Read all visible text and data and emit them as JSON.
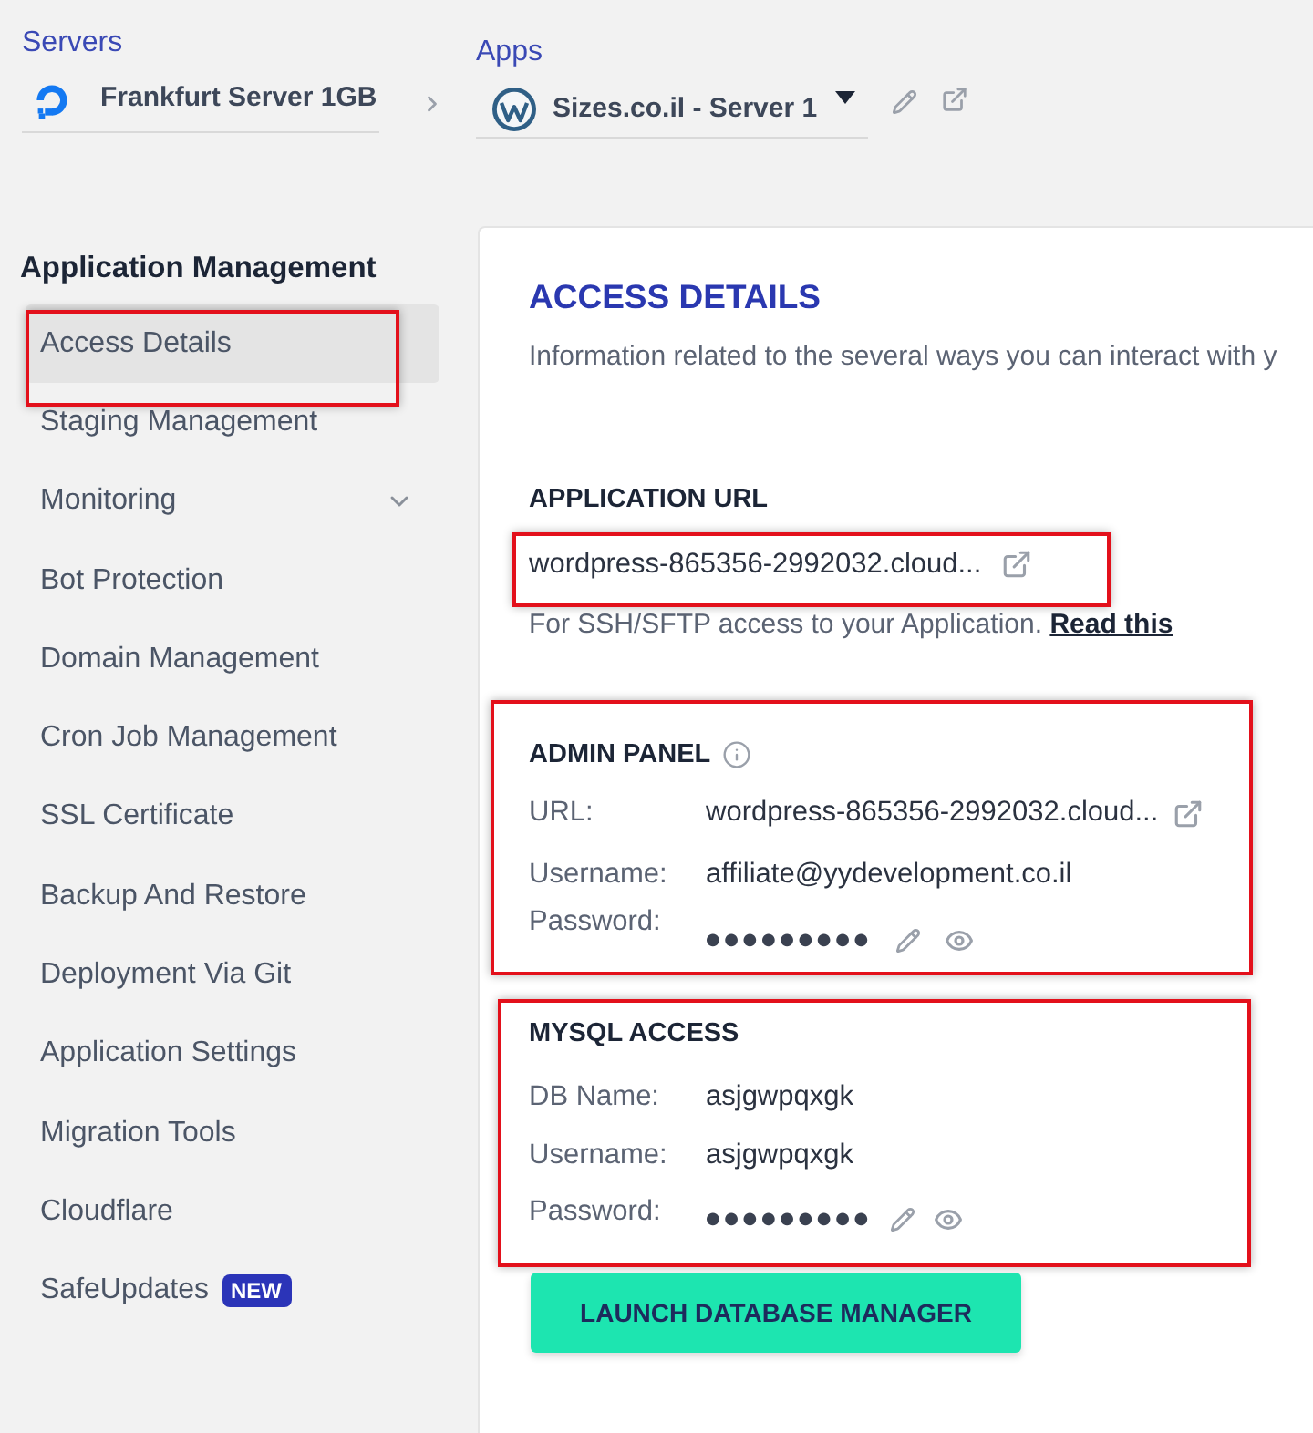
{
  "header": {
    "servers_label": "Servers",
    "server_name": "Frankfurt Server 1GB",
    "apps_label": "Apps",
    "app_name": "Sizes.co.il - Server 1"
  },
  "sidebar": {
    "heading": "Application Management",
    "items": [
      {
        "label": "Access Details",
        "kind": "link",
        "selected": true,
        "highlighted": true
      },
      {
        "label": "Staging Management",
        "kind": "link",
        "selected": false,
        "highlighted": false
      },
      {
        "label": "Monitoring",
        "kind": "group",
        "selected": false,
        "highlighted": false
      },
      {
        "label": "Bot Protection",
        "kind": "link",
        "selected": false,
        "highlighted": false
      },
      {
        "label": "Domain Management",
        "kind": "link",
        "selected": false,
        "highlighted": false
      },
      {
        "label": "Cron Job Management",
        "kind": "link",
        "selected": false,
        "highlighted": false
      },
      {
        "label": "SSL Certificate",
        "kind": "link",
        "selected": false,
        "highlighted": false
      },
      {
        "label": "Backup And Restore",
        "kind": "link",
        "selected": false,
        "highlighted": false
      },
      {
        "label": "Deployment Via Git",
        "kind": "link",
        "selected": false,
        "highlighted": false
      },
      {
        "label": "Application Settings",
        "kind": "link",
        "selected": false,
        "highlighted": false
      },
      {
        "label": "Migration Tools",
        "kind": "link",
        "selected": false,
        "highlighted": false
      },
      {
        "label": "Cloudflare",
        "kind": "link",
        "selected": false,
        "highlighted": false
      },
      {
        "label": "SafeUpdates",
        "kind": "link",
        "selected": false,
        "highlighted": false,
        "badge": "NEW"
      }
    ]
  },
  "access_details": {
    "title": "ACCESS DETAILS",
    "description": "Information related to the several ways you can interact with y",
    "application_url": {
      "heading": "APPLICATION URL",
      "url": "wordpress-865356-2992032.cloud...",
      "highlighted": true,
      "note": "For SSH/SFTP access to your Application.",
      "note_link": "Read this"
    },
    "admin_panel": {
      "heading": "ADMIN PANEL",
      "info": true,
      "highlighted": true,
      "fields": [
        {
          "label": "URL:",
          "value": "wordpress-865356-2992032.cloud...",
          "kind": "link"
        },
        {
          "label": "Username:",
          "value": "affiliate@yydevelopment.co.il",
          "kind": "text"
        },
        {
          "label": "Password:",
          "value": "●●●●●●●●●",
          "kind": "password"
        }
      ]
    },
    "mysql_access": {
      "heading": "MYSQL ACCESS",
      "highlighted": true,
      "fields": [
        {
          "label": "DB Name:",
          "value": "asjgwpqxgk",
          "kind": "text"
        },
        {
          "label": "Username:",
          "value": "asjgwpqxgk",
          "kind": "text"
        },
        {
          "label": "Password:",
          "value": "●●●●●●●●●",
          "kind": "password"
        }
      ]
    },
    "launch_button": "LAUNCH DATABASE MANAGER"
  }
}
